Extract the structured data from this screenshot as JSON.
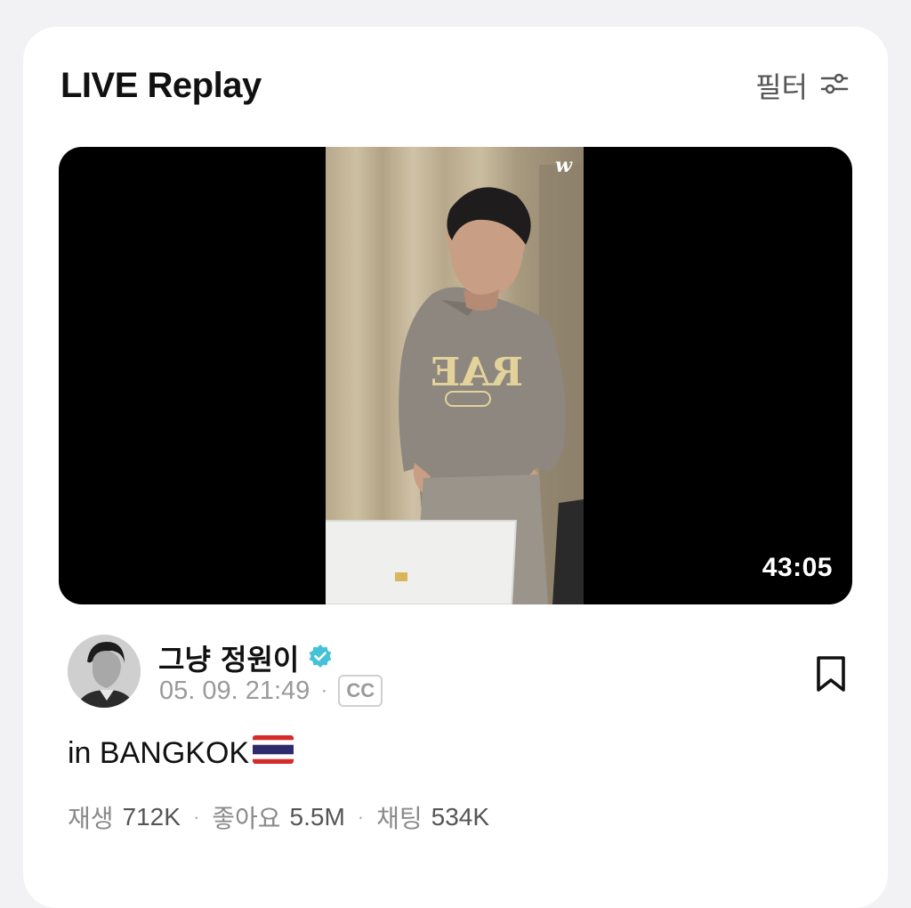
{
  "header": {
    "title": "LIVE Replay",
    "filter_label": "필터"
  },
  "video": {
    "duration": "43:05",
    "watermark": "w"
  },
  "post": {
    "channel_name": "그냥 정원이",
    "verified": true,
    "datetime": "05. 09. 21:49",
    "cc_label": "CC",
    "caption": "in BANGKOK",
    "flag": "Thailand"
  },
  "stats": {
    "plays_label": "재생",
    "plays_value": "712K",
    "likes_label": "좋아요",
    "likes_value": "5.5M",
    "chats_label": "채팅",
    "chats_value": "534K"
  },
  "colors": {
    "verified_badge": "#45c1d8",
    "video_background": "#000000",
    "card_background": "#ffffff"
  }
}
